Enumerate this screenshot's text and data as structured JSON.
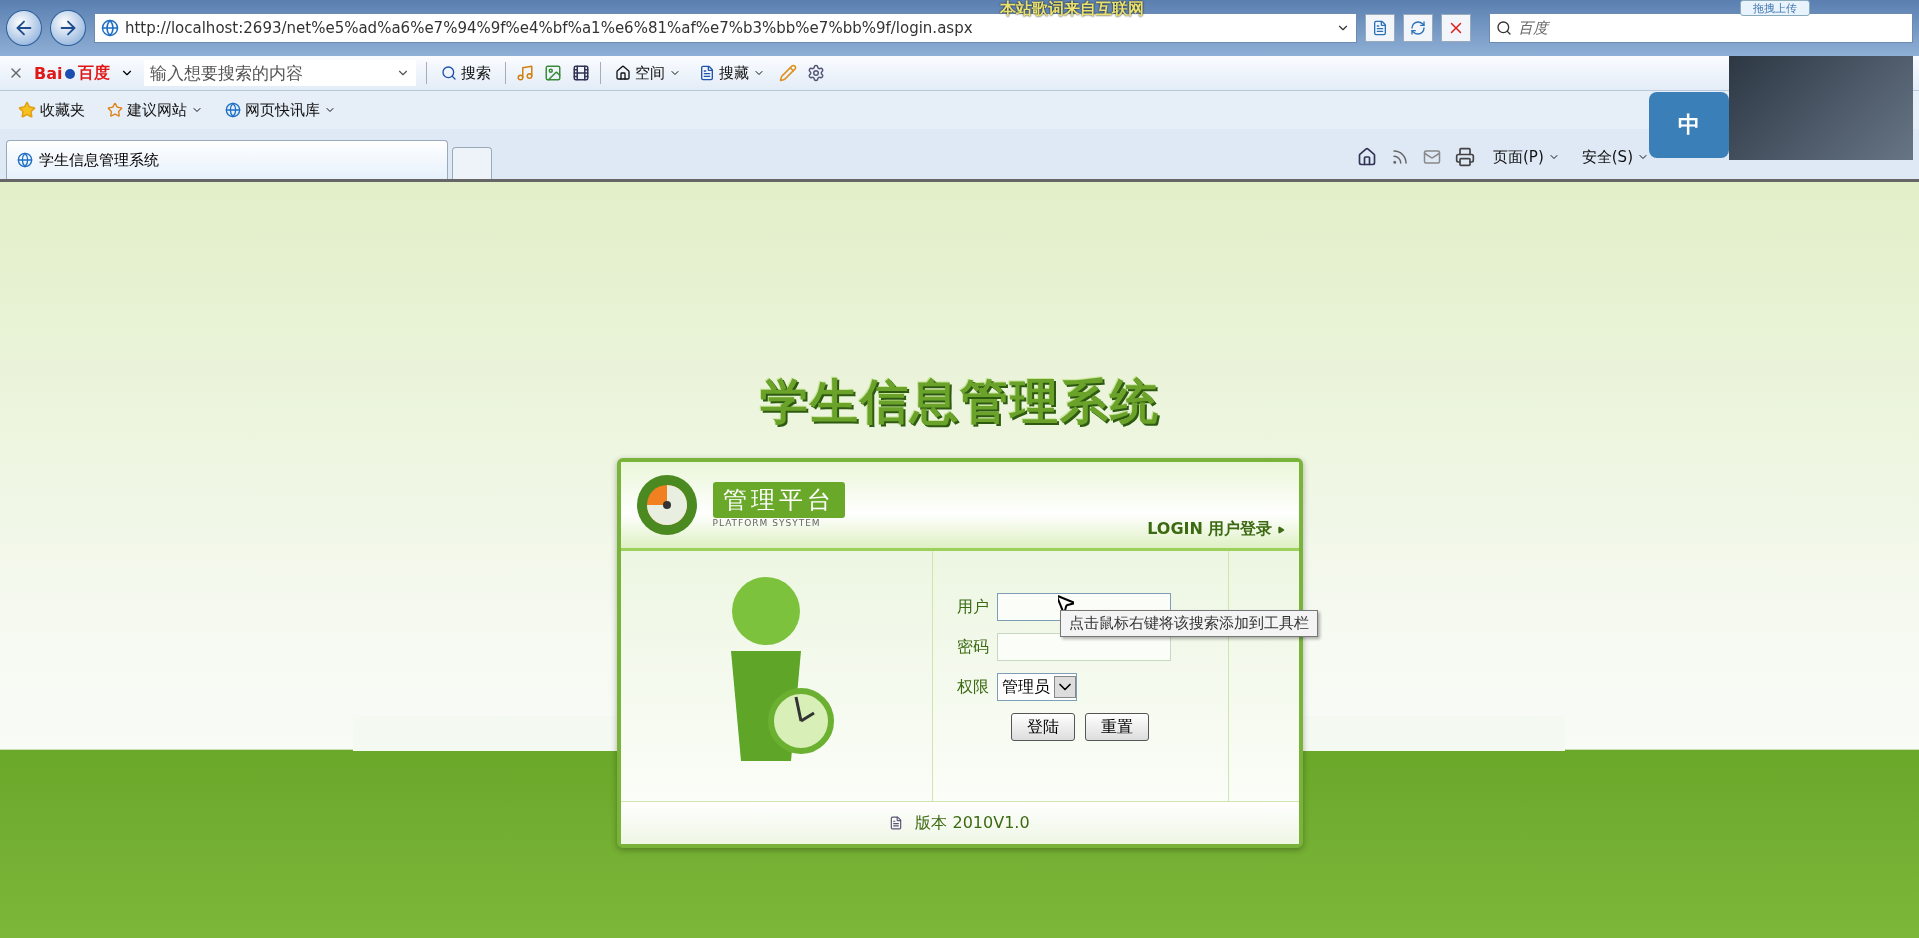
{
  "browser": {
    "url": "http://localhost:2693/net%e5%ad%a6%e7%94%9f%e4%bf%a1%e6%81%af%e7%b3%bb%e7%bb%9f/login.aspx",
    "search_placeholder": "百度",
    "lyrics_overlay": "本站歌词来自互联网",
    "upload_button": "拖拽上传"
  },
  "toolbar": {
    "logo": [
      "Bai",
      "百度"
    ],
    "search_placeholder": "输入想要搜索的内容",
    "search_button": "搜索",
    "items": [
      "空间",
      "搜藏"
    ]
  },
  "favorites": {
    "title": "收藏夹",
    "items": [
      "建议网站",
      "网页快讯库"
    ]
  },
  "tabs": [
    {
      "label": "学生信息管理系统",
      "selected": true
    }
  ],
  "command_bar": [
    "页面(P)",
    "安全(S)"
  ],
  "ime": {
    "label": "中"
  },
  "page": {
    "title": "学生信息管理系统",
    "panel": {
      "badge": "管理平台",
      "subtitle": "PLATFORM SYSYTEM",
      "login_link": "LOGIN 用户登录",
      "fields": [
        {
          "label": "用户",
          "kind": "text",
          "focused": true
        },
        {
          "label": "密码",
          "kind": "password",
          "focused": false
        },
        {
          "label": "权限",
          "kind": "select",
          "value": "管理员"
        }
      ],
      "buttons": [
        "登陆",
        "重置"
      ],
      "version": "版本 2010V1.0"
    },
    "tooltip": "点击鼠标右键将该搜索添加到工具栏"
  }
}
